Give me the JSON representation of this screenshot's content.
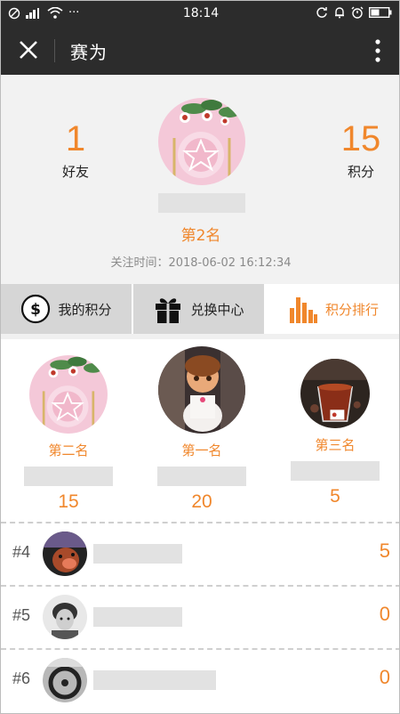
{
  "status_bar": {
    "time": "18:14",
    "left_icons": [
      "no-disturb-icon",
      "signal-icon",
      "wifi-icon",
      "more-dots-icon"
    ],
    "right_icons": [
      "sync-icon",
      "bell-icon",
      "alarm-icon",
      "battery-icon"
    ],
    "more_dots": "···"
  },
  "nav": {
    "title": "赛为",
    "close_icon": "close-icon",
    "more_icon": "vertical-dots-icon"
  },
  "profile": {
    "friends_count": "1",
    "friends_label": "好友",
    "points_count": "15",
    "points_label": "积分",
    "rank_text": "第2名",
    "follow_time": "关注时间：2018-06-02 16:12:34"
  },
  "tabs": [
    {
      "label": "我的积分",
      "icon": "dollar-circle-icon",
      "active": false
    },
    {
      "label": "兑换中心",
      "icon": "gift-icon",
      "active": false
    },
    {
      "label": "积分排行",
      "icon": "bar-chart-icon",
      "active": true
    }
  ],
  "podium": {
    "second": {
      "label": "第二名",
      "score": "15"
    },
    "first": {
      "label": "第一名",
      "score": "20"
    },
    "third": {
      "label": "第三名",
      "score": "5"
    }
  },
  "ranking_list": [
    {
      "rank": "#4",
      "score": "5"
    },
    {
      "rank": "#5",
      "score": "0"
    },
    {
      "rank": "#6",
      "score": "0"
    }
  ],
  "colors": {
    "accent": "#f0872c",
    "topbar": "#2c2c2c",
    "profile_bg": "#f2f2f2",
    "tab_inactive": "#d6d6d6",
    "placeholder": "#e2e2e2"
  }
}
